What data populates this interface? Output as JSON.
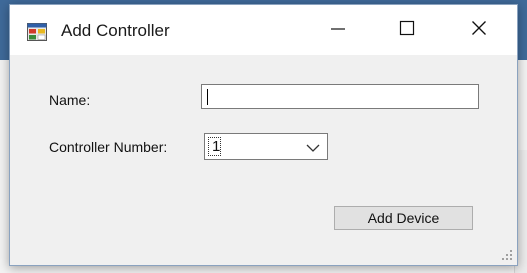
{
  "window": {
    "title": "Add Controller",
    "icon": "app-window-icon",
    "controls": [
      "minimize-icon",
      "maximize-icon",
      "close-icon"
    ]
  },
  "form": {
    "name_label": "Name:",
    "name_value": "",
    "controller_label": "Controller Number:",
    "controller_value": "1",
    "add_button_label": "Add Device"
  },
  "colors": {
    "accent": "#3f6a9a",
    "dialog_background": "#f0f0f0",
    "titlebar_background": "#ffffff"
  }
}
